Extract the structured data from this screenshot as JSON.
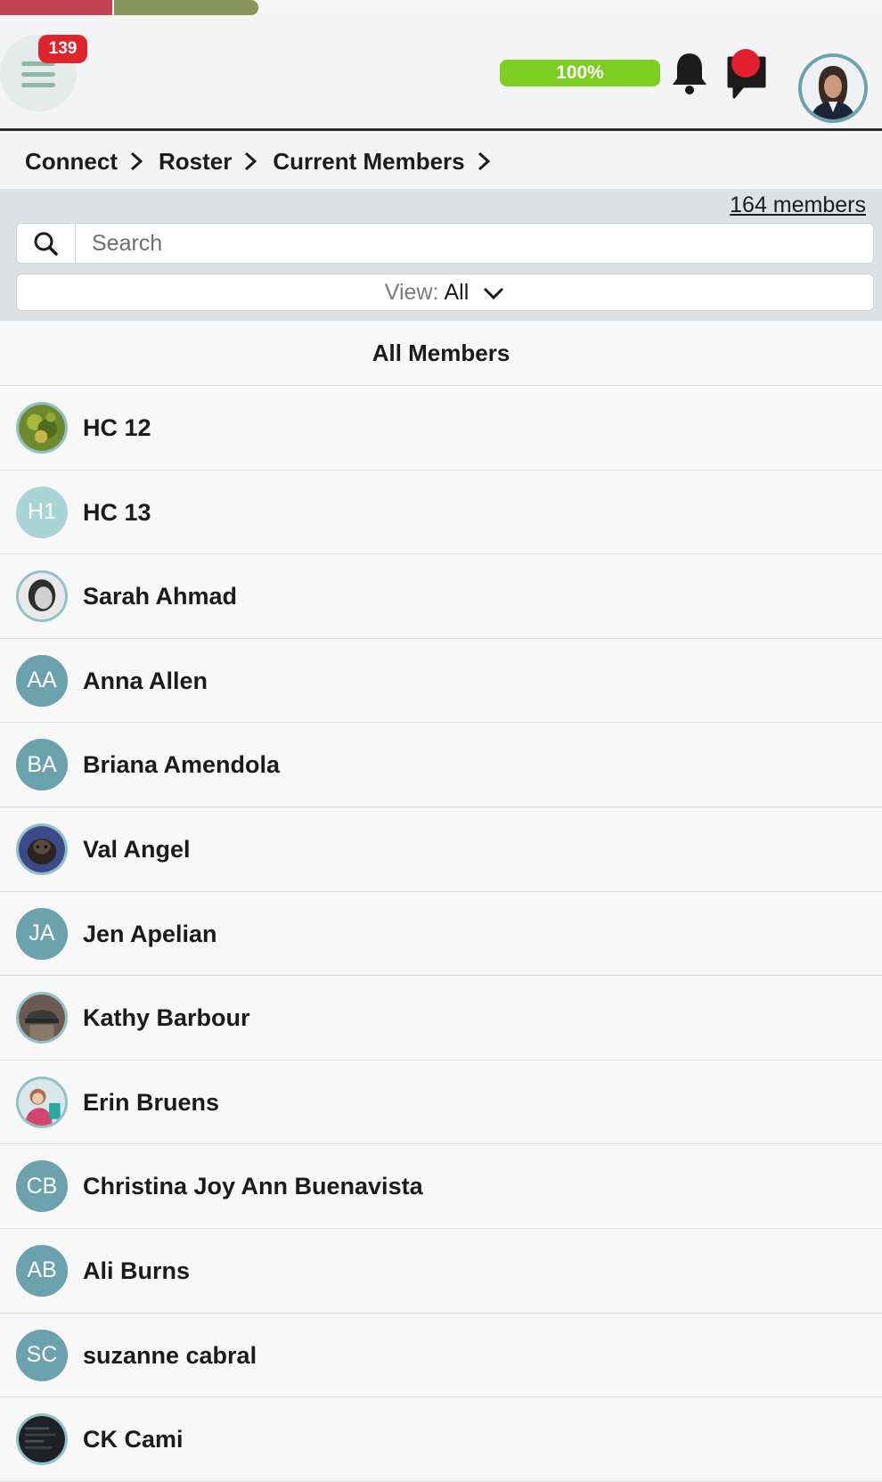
{
  "header": {
    "menu_badge": "139",
    "progress_label": "100%",
    "progress_value": 1.0
  },
  "breadcrumb": [
    "Connect",
    "Roster",
    "Current Members"
  ],
  "filter": {
    "member_count": "164 members",
    "search_placeholder": "Search",
    "view_label": "View:",
    "view_value": "All"
  },
  "section_title": "All Members",
  "members": [
    {
      "name": "HC 12",
      "avatar": "photo-tree"
    },
    {
      "name": "HC 13",
      "avatar": "initials",
      "initials": "H1"
    },
    {
      "name": "Sarah Ahmad",
      "avatar": "photo-woman"
    },
    {
      "name": "Anna Allen",
      "avatar": "initials",
      "initials": "AA"
    },
    {
      "name": "Briana Amendola",
      "avatar": "initials",
      "initials": "BA"
    },
    {
      "name": "Val Angel",
      "avatar": "photo-dog"
    },
    {
      "name": "Jen Apelian",
      "avatar": "initials",
      "initials": "JA"
    },
    {
      "name": "Kathy Barbour",
      "avatar": "photo-hat"
    },
    {
      "name": "Erin Bruens",
      "avatar": "photo-person"
    },
    {
      "name": "Christina Joy Ann Buenavista",
      "avatar": "initials",
      "initials": "CB"
    },
    {
      "name": "Ali Burns",
      "avatar": "initials",
      "initials": "AB"
    },
    {
      "name": "suzanne cabral",
      "avatar": "initials",
      "initials": "SC"
    },
    {
      "name": "CK Cami",
      "avatar": "photo-dark"
    }
  ],
  "colors": {
    "badge": "#e0242e",
    "progress": "#7ccf21",
    "avatar_teal": "#6ba2ae",
    "header_border": "#2b2b2b"
  }
}
